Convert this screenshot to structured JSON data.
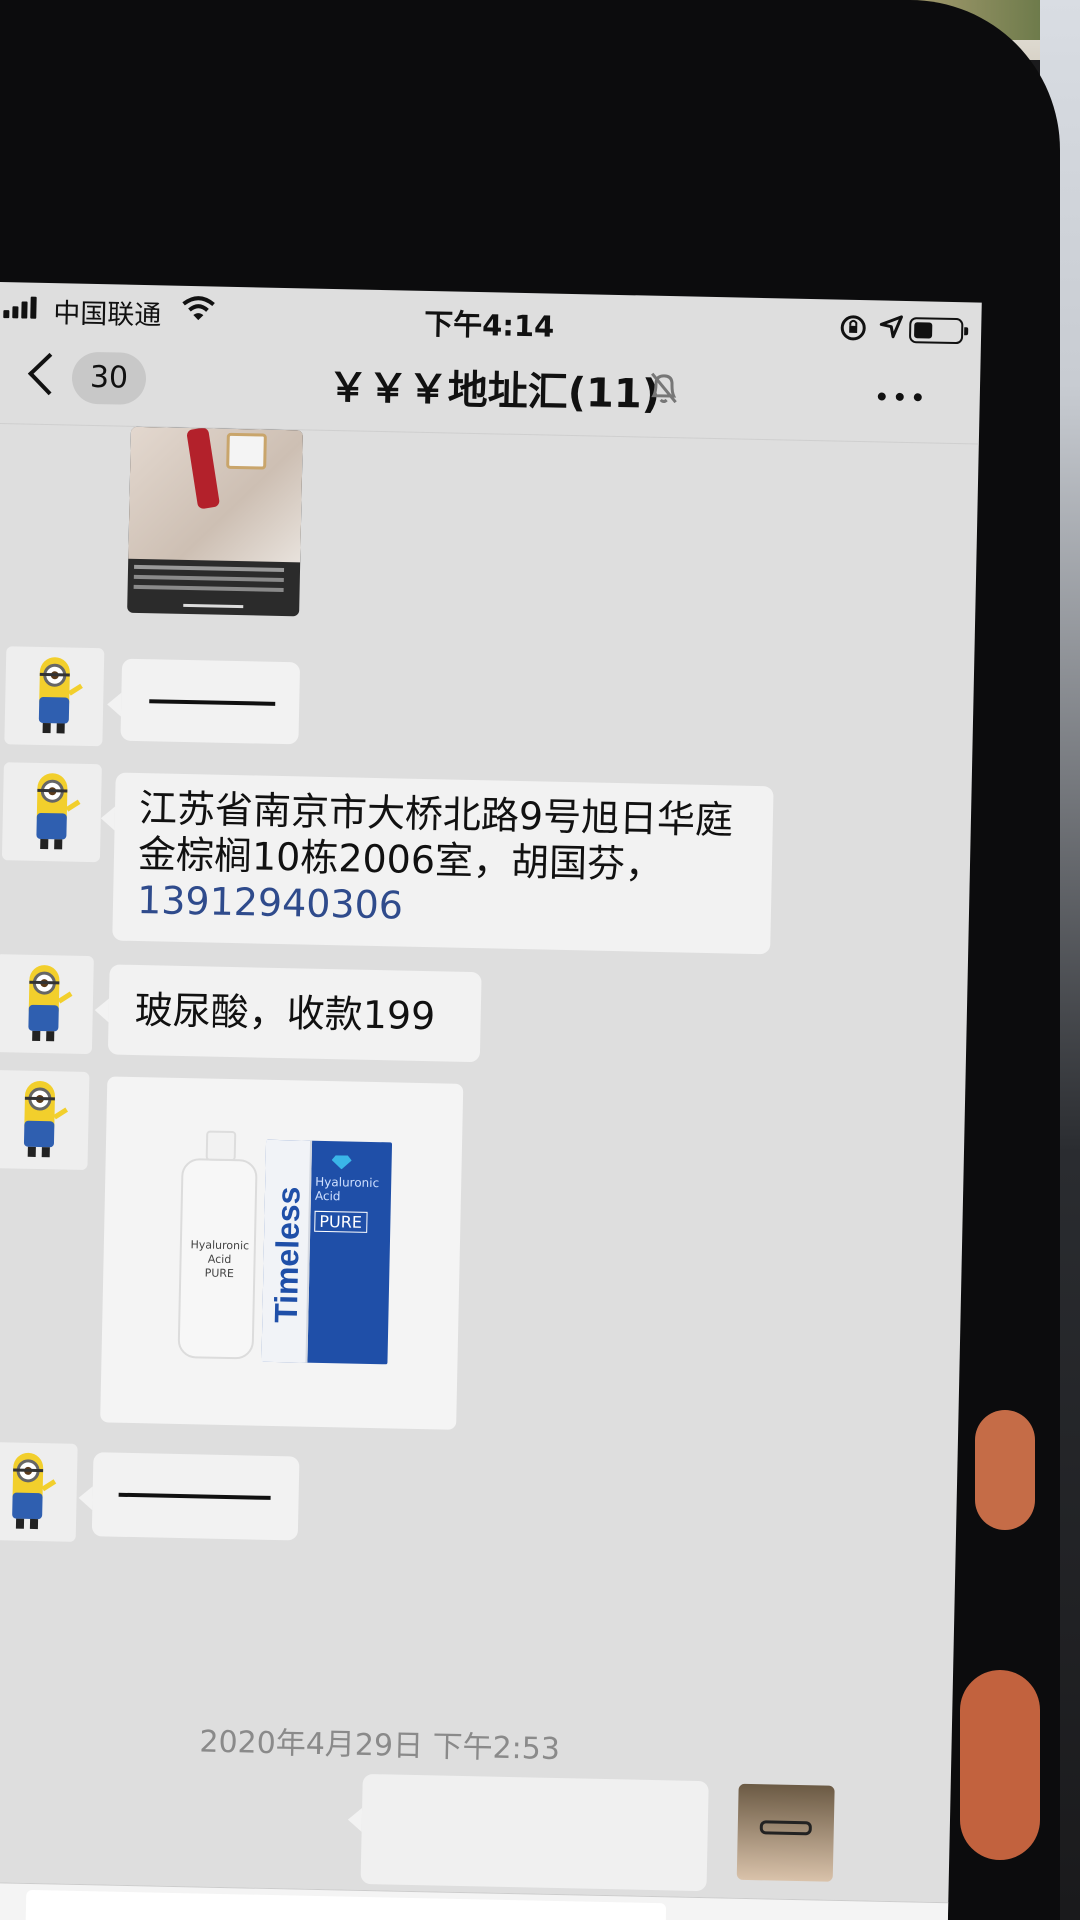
{
  "status_bar": {
    "carrier": "中国联通",
    "time": "下午4:14"
  },
  "nav": {
    "back_count": "30",
    "title": "￥￥￥地址汇(11)"
  },
  "messages": {
    "m1": {
      "text": ""
    },
    "m2": {
      "text": "江苏省南京市大桥北路9号旭日华庭金棕榈10栋2006室，胡国芬，",
      "phone": "13912940306"
    },
    "m3": {
      "text": "玻尿酸，收款199"
    },
    "m4": {
      "brand": "Timeless",
      "product_line1": "Hyaluronic",
      "product_line2": "Acid",
      "grade": "PURE",
      "bottle_label": "Hyaluronic Acid",
      "bottle_sub": "PURE"
    }
  },
  "timestamp": "2020年4月29日 下午2:53",
  "colors": {
    "screen_bg": "#dedede",
    "bubble": "#f2f2f2",
    "link": "#2f4b8c",
    "brand_blue": "#1f4fa8"
  }
}
